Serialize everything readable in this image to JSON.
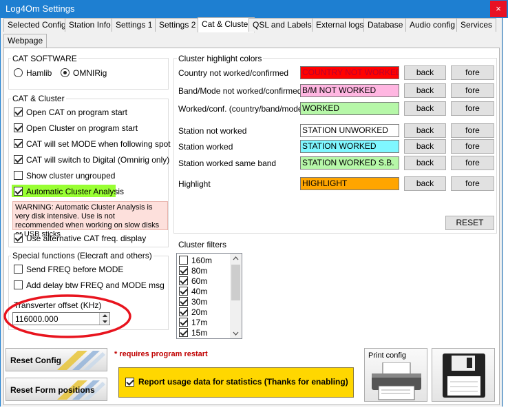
{
  "window": {
    "title": "Log4Om Settings",
    "close_glyph": "×"
  },
  "tabs": [
    {
      "label": "Selected Config"
    },
    {
      "label": "Station Info"
    },
    {
      "label": "Settings 1"
    },
    {
      "label": "Settings 2"
    },
    {
      "label": "Cat & Cluster"
    },
    {
      "label": "QSL and Labels"
    },
    {
      "label": "External logs"
    },
    {
      "label": "Database"
    },
    {
      "label": "Audio config"
    },
    {
      "label": "Services"
    },
    {
      "label": "Webpage"
    }
  ],
  "cat_software": {
    "title": "CAT SOFTWARE",
    "options": [
      {
        "label": "Hamlib",
        "selected": false
      },
      {
        "label": "OMNIRig",
        "selected": true
      }
    ]
  },
  "cat_cluster": {
    "title": "CAT & Cluster",
    "items": [
      {
        "label": "Open CAT on program start",
        "checked": true
      },
      {
        "label": "Open Cluster on program start",
        "checked": true
      },
      {
        "label": "CAT will set MODE when following spot",
        "checked": true
      },
      {
        "label": "CAT will switch to Digital (Omnirig only)",
        "checked": true
      },
      {
        "label": "Show cluster ungrouped",
        "checked": false
      },
      {
        "label": "Automatic Cluster Analysis",
        "checked": true
      }
    ],
    "warning": "WARNING: Automatic Cluster Analysis is very disk intensive. Use is not recommended when working on slow disks or USB sticks",
    "alt_freq": {
      "label": "Use alternative CAT freq. display",
      "checked": true
    },
    "highlight_color": "#99ff33",
    "warning_bg": "#fde0dc"
  },
  "special": {
    "title": "Special functions (Elecraft and others)",
    "items": [
      {
        "label": "Send FREQ before MODE",
        "checked": false
      },
      {
        "label": "Add delay btw FREQ and MODE msg",
        "checked": false
      }
    ],
    "transverter_label": "Transverter offset (KHz)",
    "transverter_value": "116000.000"
  },
  "highlight": {
    "title": "Cluster highlight colors",
    "back_label": "back",
    "fore_label": "fore",
    "reset_label": "RESET",
    "rows": [
      {
        "label": "Country not worked/confirmed",
        "value": "COUNTRY NOT WORKED",
        "bg": "#ff0000"
      },
      {
        "label": "Band/Mode not worked/confirmed",
        "value": "B/M NOT WORKED",
        "bg": "#ffb6e1"
      },
      {
        "label": "Worked/conf. (country/band/mode)",
        "value": "WORKED",
        "bg": "#b6f7a8"
      },
      {
        "label": "Station not worked",
        "value": "STATION UNWORKED",
        "bg": "#ffffff"
      },
      {
        "label": "Station worked",
        "value": "STATION WORKED",
        "bg": "#7ff7ff"
      },
      {
        "label": "Station worked same band",
        "value": "STATION WORKED S.B.",
        "bg": "#b6f7a8"
      },
      {
        "label": "Highlight",
        "value": "HIGHLIGHT",
        "bg": "#ffa500"
      }
    ]
  },
  "cluster_filters": {
    "title": "Cluster filters",
    "bands": [
      {
        "label": "160m",
        "checked": false
      },
      {
        "label": "80m",
        "checked": true
      },
      {
        "label": "60m",
        "checked": true
      },
      {
        "label": "40m",
        "checked": true
      },
      {
        "label": "30m",
        "checked": true
      },
      {
        "label": "20m",
        "checked": true
      },
      {
        "label": "17m",
        "checked": true
      },
      {
        "label": "15m",
        "checked": true
      }
    ]
  },
  "bottom": {
    "reset_config": "Reset Config",
    "reset_forms": "Reset Form positions",
    "restart_note": "* requires program restart",
    "usage_label": "Report usage data for statistics (Thanks for enabling)",
    "usage_checked": true,
    "usage_bg": "#ffd700",
    "print_label": "Print config"
  }
}
